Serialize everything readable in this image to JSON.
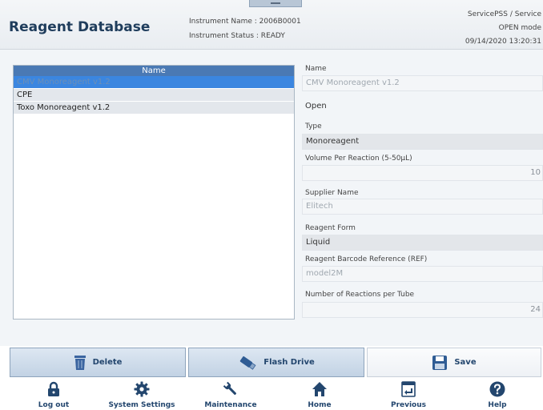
{
  "header": {
    "title": "Reagent Database",
    "instrument_name": "Instrument Name : 2006B0001",
    "instrument_status": "Instrument Status : READY",
    "user": "ServicePSS / Service",
    "mode": "OPEN mode",
    "datetime": "09/14/2020 13:20:31"
  },
  "list": {
    "header": "Name",
    "items": [
      "CMV Monoreagent v1.2",
      "CPE",
      "Toxo Monoreagent v1.2"
    ]
  },
  "form": {
    "name_label": "Name",
    "name_value": "CMV Monoreagent v1.2",
    "open_label": "Open",
    "type_label": "Type",
    "type_value": "Monoreagent",
    "volume_label": "Volume Per Reaction (5-50µL)",
    "volume_value": "10",
    "supplier_label": "Supplier Name",
    "supplier_value": "Elitech",
    "form_label": "Reagent Form",
    "form_value": "Liquid",
    "barcode_label": "Reagent Barcode Reference (REF)",
    "barcode_value": "model2M",
    "reactions_label": "Number of Reactions per Tube",
    "reactions_value": "24"
  },
  "actions": {
    "delete": "Delete",
    "flash_drive": "Flash Drive",
    "save": "Save"
  },
  "nav": {
    "logout": "Log out",
    "system_settings": "System Settings",
    "maintenance": "Maintenance",
    "home": "Home",
    "previous": "Previous",
    "help": "Help"
  },
  "icons": {
    "delete": "trash-icon",
    "flash_drive": "usb-drive-icon",
    "save": "floppy-disk-icon",
    "logout": "lock-icon",
    "system_settings": "gear-icon",
    "maintenance": "wrench-icon",
    "home": "house-icon",
    "previous": "back-arrow-icon",
    "help": "question-mark-icon"
  },
  "colors": {
    "accent": "#3b86e0",
    "list_header": "#4a79b4",
    "icon_dark": "#23466e"
  }
}
